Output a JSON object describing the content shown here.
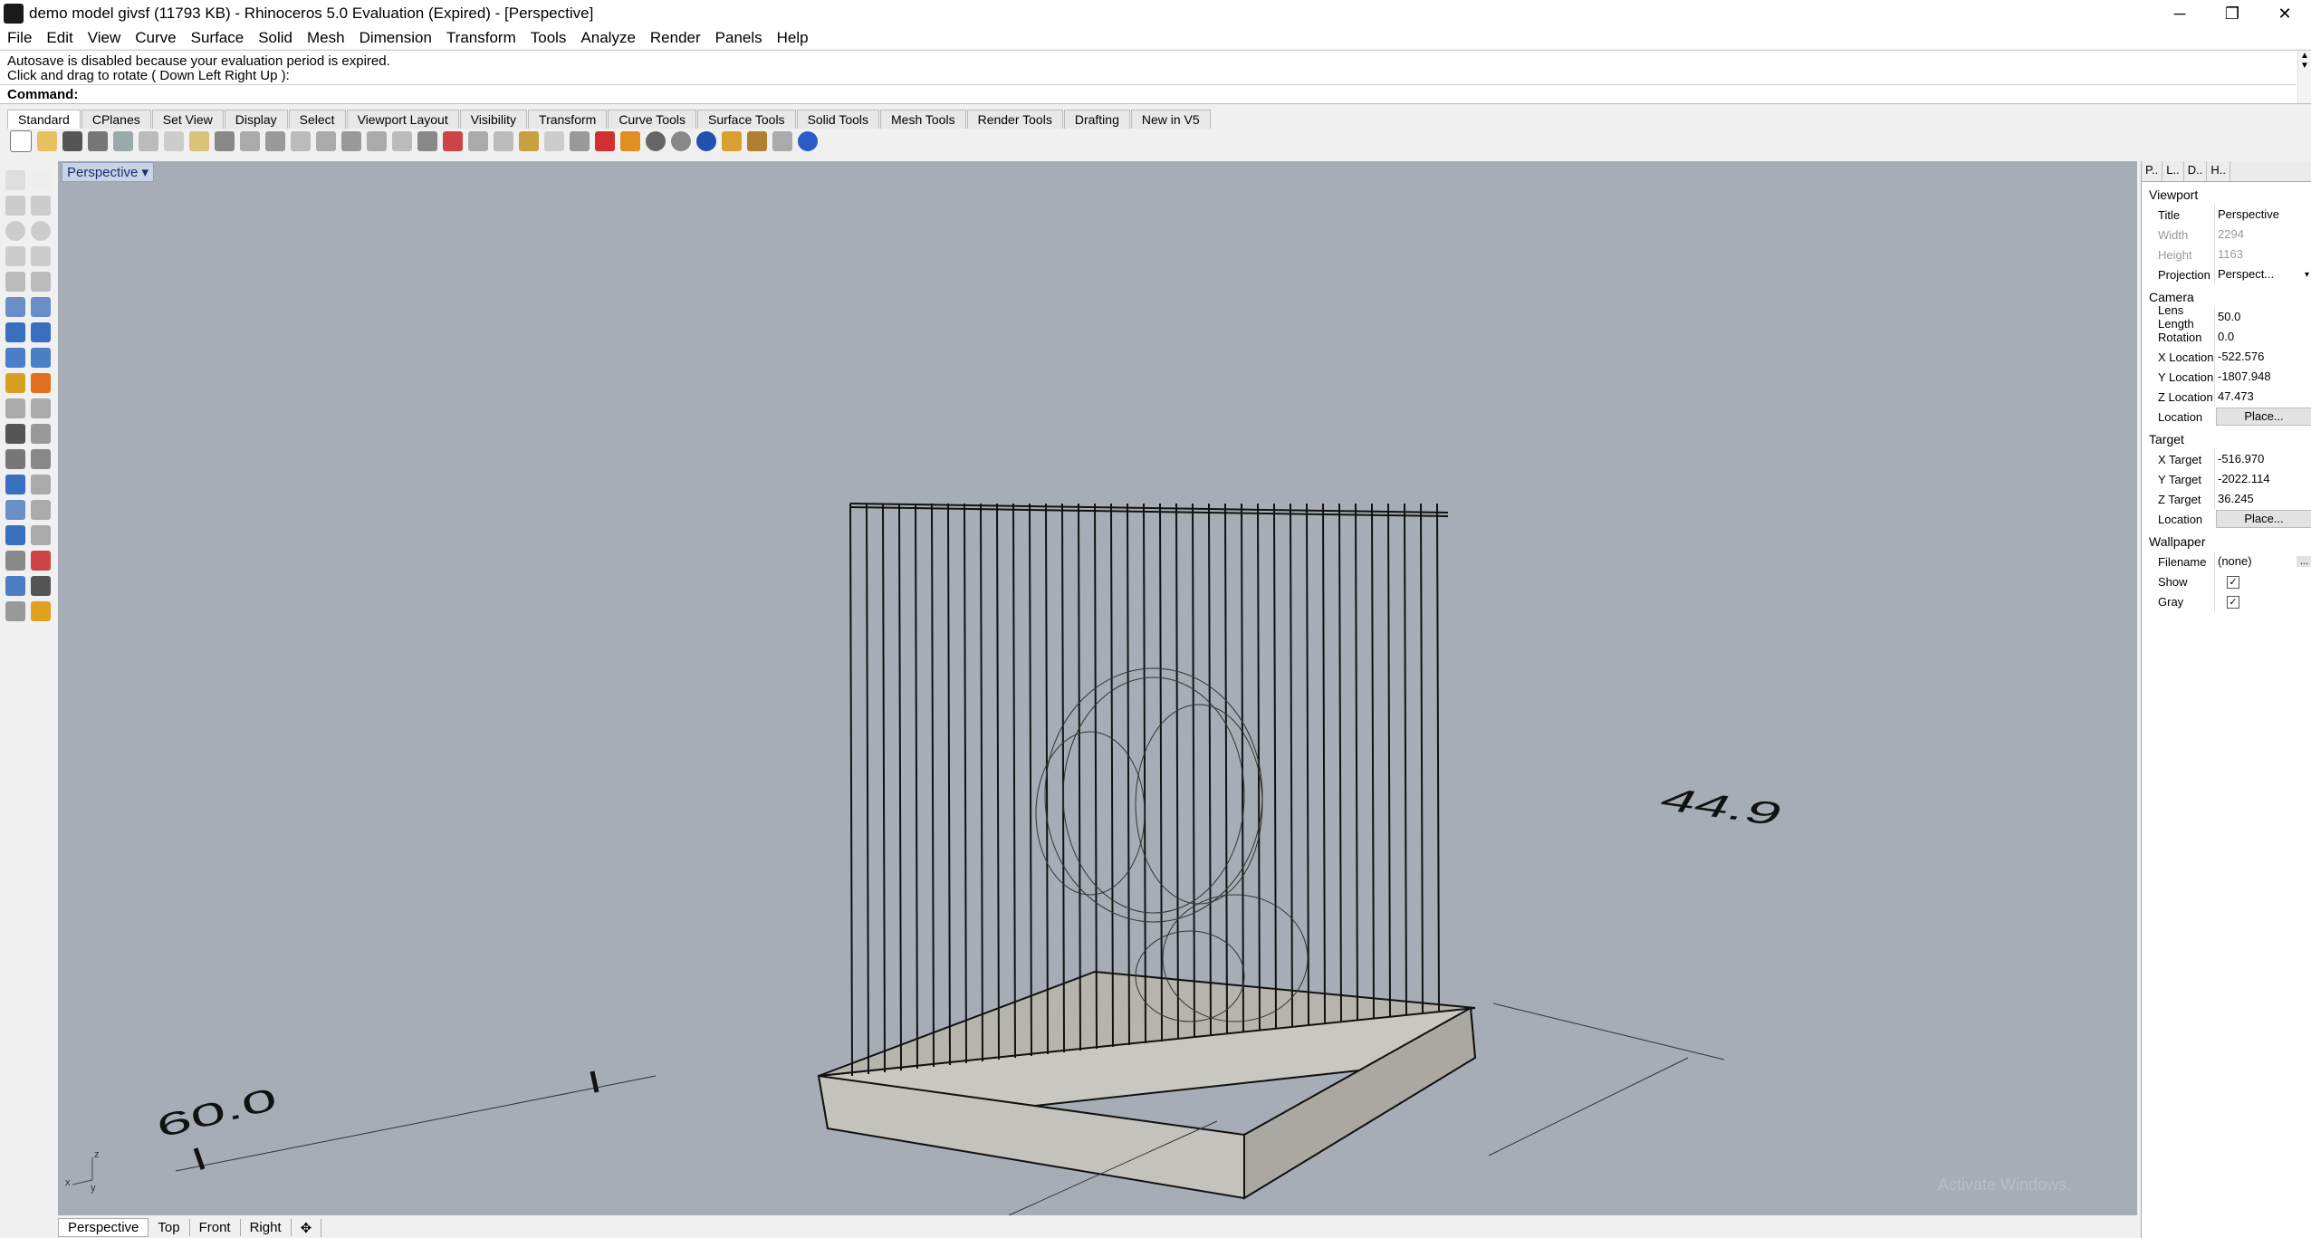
{
  "window": {
    "title": "demo model givsf (11793 KB) - Rhinoceros 5.0 Evaluation (Expired) - [Perspective]",
    "minimize": "─",
    "restore": "❐",
    "close": "✕"
  },
  "menu": [
    "File",
    "Edit",
    "View",
    "Curve",
    "Surface",
    "Solid",
    "Mesh",
    "Dimension",
    "Transform",
    "Tools",
    "Analyze",
    "Render",
    "Panels",
    "Help"
  ],
  "command": {
    "line1": "Autosave is disabled because your evaluation period is expired.",
    "line2": "Click and drag to rotate ( Down  Left  Right  Up ):",
    "prompt": "Command:",
    "input": ""
  },
  "toolbar_tabs": [
    "Standard",
    "CPlanes",
    "Set View",
    "Display",
    "Select",
    "Viewport Layout",
    "Visibility",
    "Transform",
    "Curve Tools",
    "Surface Tools",
    "Solid Tools",
    "Mesh Tools",
    "Render Tools",
    "Drafting",
    "New in V5"
  ],
  "viewport": {
    "title": "Perspective",
    "dimension_left": "60.0",
    "dimension_right": "44.9",
    "axis_z": "z",
    "axis_x": "x",
    "axis_y": "y",
    "watermark": "Activate Windows."
  },
  "viewport_tabs": [
    "Perspective",
    "Top",
    "Front",
    "Right"
  ],
  "panel": {
    "tabs": [
      "P..",
      "L..",
      "D..",
      "H.."
    ],
    "viewport_section": "Viewport",
    "title_label": "Title",
    "title_value": "Perspective",
    "width_label": "Width",
    "width_value": "2294",
    "height_label": "Height",
    "height_value": "1163",
    "projection_label": "Projection",
    "projection_value": "Perspect...",
    "camera_section": "Camera",
    "lens_label": "Lens Length",
    "lens_value": "50.0",
    "rotation_label": "Rotation",
    "rotation_value": "0.0",
    "xloc_label": "X Location",
    "xloc_value": "-522.576",
    "yloc_label": "Y Location",
    "yloc_value": "-1807.948",
    "zloc_label": "Z Location",
    "zloc_value": "47.473",
    "location_label": "Location",
    "place_label": "Place...",
    "target_section": "Target",
    "xt_label": "X Target",
    "xt_value": "-516.970",
    "yt_label": "Y Target",
    "yt_value": "-2022.114",
    "zt_label": "Z Target",
    "zt_value": "36.245",
    "tlocation_label": "Location",
    "tplace_label": "Place...",
    "wallpaper_section": "Wallpaper",
    "filename_label": "Filename",
    "filename_value": "(none)",
    "show_label": "Show",
    "gray_label": "Gray"
  }
}
